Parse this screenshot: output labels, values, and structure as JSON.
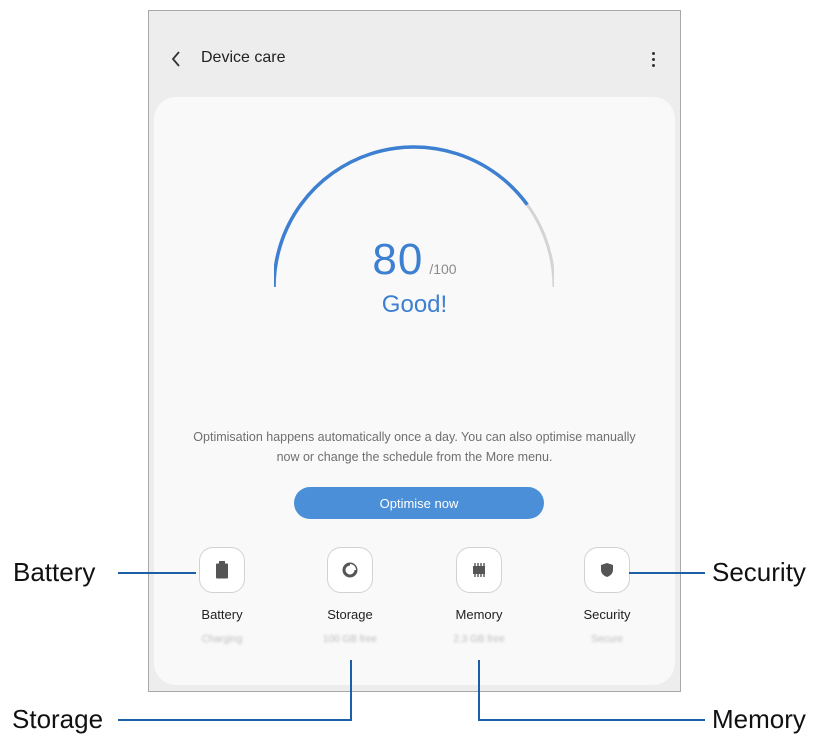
{
  "header": {
    "title": "Device care"
  },
  "score": {
    "value": "80",
    "max": "/100",
    "fraction": 0.8,
    "status": "Good!"
  },
  "description": {
    "line1": "Optimisation happens automatically once a day. You can also optimise manually",
    "line2": "now or change the schedule from the More menu."
  },
  "optimise_button": "Optimise now",
  "tiles": [
    {
      "label": "Battery",
      "sub": "Charging"
    },
    {
      "label": "Storage",
      "sub": "100 GB free"
    },
    {
      "label": "Memory",
      "sub": "2.3 GB free"
    },
    {
      "label": "Security",
      "sub": "Secure"
    }
  ],
  "callouts": {
    "battery": "Battery",
    "storage": "Storage",
    "memory": "Memory",
    "security": "Security"
  },
  "colors": {
    "accent": "#3d7fd1",
    "button": "#4a8fd8",
    "callout_line": "#1b5fa6",
    "gauge_track": "#d4d4d4"
  },
  "icons": [
    "back-arrow-icon",
    "more-options-icon",
    "battery-icon",
    "storage-icon",
    "memory-icon",
    "shield-icon"
  ]
}
